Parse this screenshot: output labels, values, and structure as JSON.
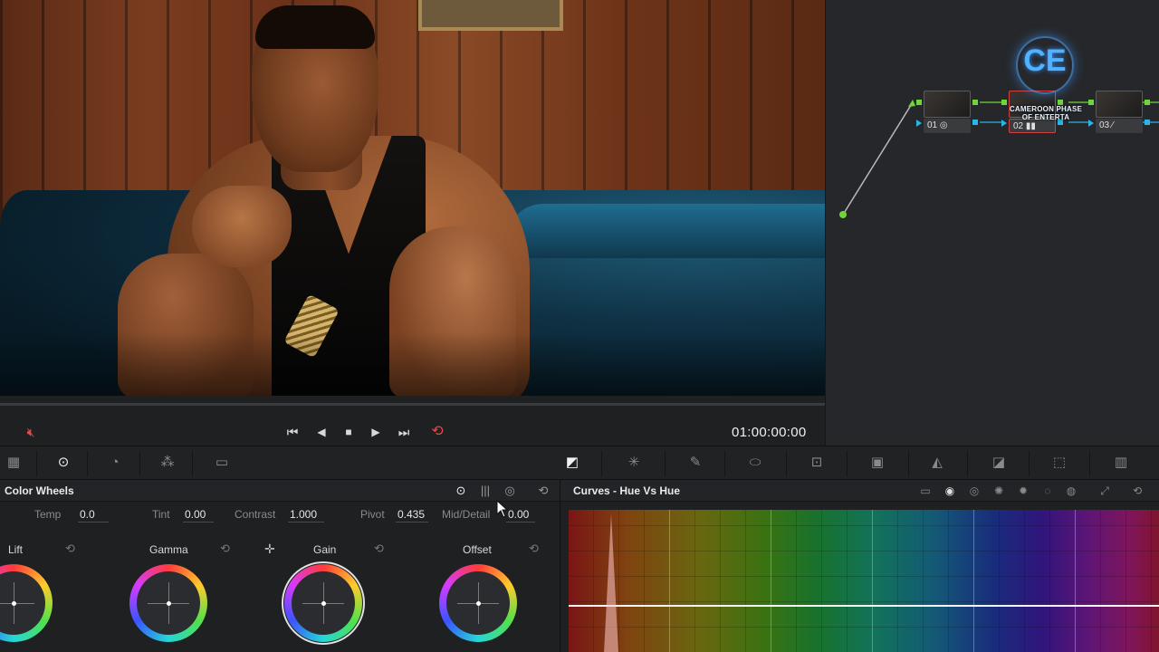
{
  "transport": {
    "timecode": "01:00:00:00",
    "icons": [
      "mute-icon",
      "skip-back-icon",
      "prev-frame-icon",
      "stop-icon",
      "play-icon",
      "skip-forward-icon",
      "loop-icon"
    ]
  },
  "nodes": [
    {
      "label": "01"
    },
    {
      "label": "02",
      "selected": true
    },
    {
      "label": "03"
    }
  ],
  "watermark": {
    "glyph": "CE",
    "line1": "CAMEROON PHASE",
    "line2": "OF ENTERTA"
  },
  "color_wheels": {
    "title": "Color Wheels",
    "params": [
      {
        "label": "Temp",
        "value": "0.0"
      },
      {
        "label": "Tint",
        "value": "0.00"
      },
      {
        "label": "Contrast",
        "value": "1.000"
      },
      {
        "label": "Pivot",
        "value": "0.435"
      },
      {
        "label": "Mid/Detail",
        "value": "0.00"
      }
    ],
    "wheels": [
      {
        "name": "Lift"
      },
      {
        "name": "Gamma"
      },
      {
        "name": "Gain"
      },
      {
        "name": "Offset"
      }
    ]
  },
  "curves": {
    "title": "Curves - Hue Vs Hue"
  },
  "colors": {
    "accent_red": "#e24a4a",
    "node_green": "#6fd63a",
    "node_blue": "#2bb4e6",
    "panel_bg": "#1f2022"
  }
}
